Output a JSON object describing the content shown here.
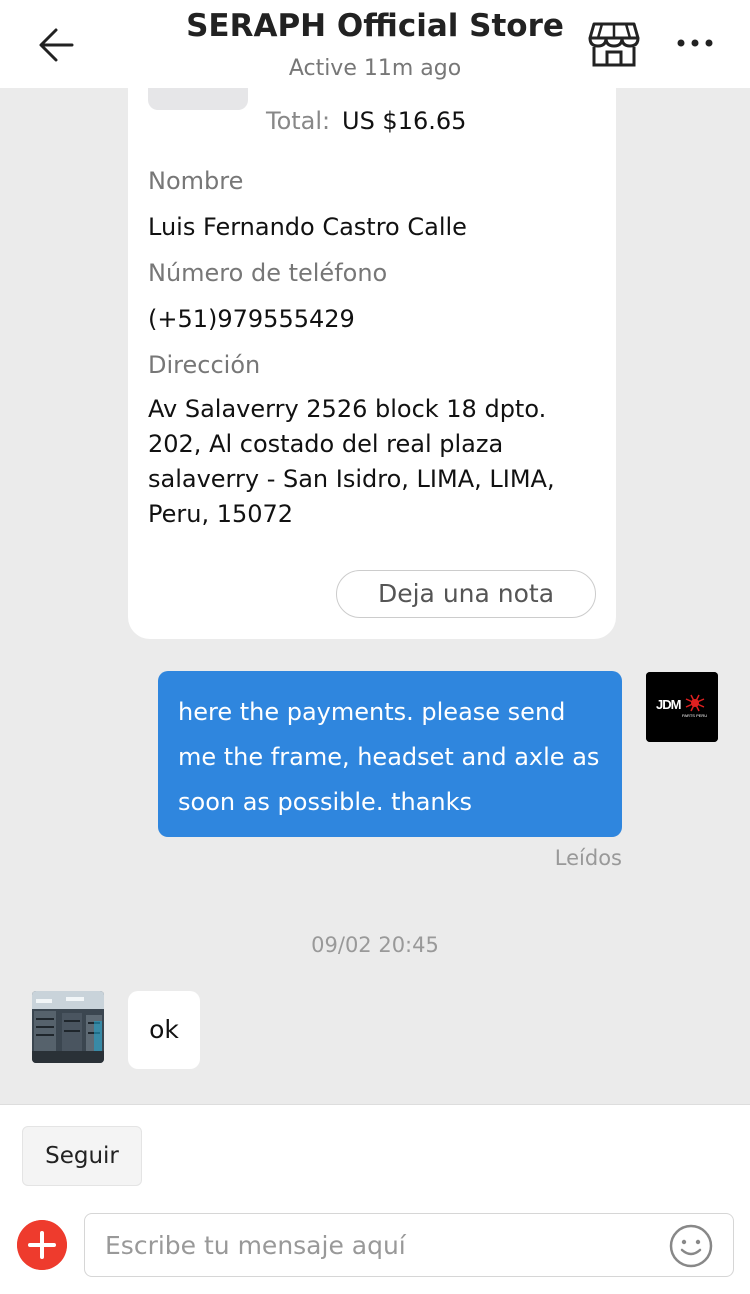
{
  "header": {
    "title": "SERAPH Official Store",
    "status": "Active 11m ago"
  },
  "order_card": {
    "total_label": "Total:",
    "total_value": "US $16.65",
    "name_label": "Nombre",
    "name_value": "Luis Fernando Castro Calle",
    "phone_label": "Número de teléfono",
    "phone_value": "(+51)979555429",
    "address_label": "Dirección",
    "address_value": "Av Salaverry 2526 block 18 dpto. 202, Al costado del real plaza salaverry - San Isidro, LIMA, LIMA, Peru, 15072",
    "note_button": "Deja una nota"
  },
  "messages": {
    "outgoing_text": "here the payments. please send me the frame, headset and axle as soon as possible. thanks",
    "outgoing_status": "Leídos",
    "outgoing_avatar_logo": "JDM",
    "outgoing_avatar_sub": "PARTS PERU",
    "timestamp": "09/02 20:45",
    "incoming_text": "ok"
  },
  "footer": {
    "follow_button": "Seguir",
    "input_placeholder": "Escribe tu mensaje aquí"
  },
  "icons": {
    "back": "arrow-left-icon",
    "store": "store-icon",
    "more": "more-icon",
    "add": "plus-icon",
    "emoji": "smiley-icon"
  },
  "colors": {
    "accent_blue": "#2f86de",
    "add_red": "#ee3b2d",
    "background": "#ebebeb"
  }
}
